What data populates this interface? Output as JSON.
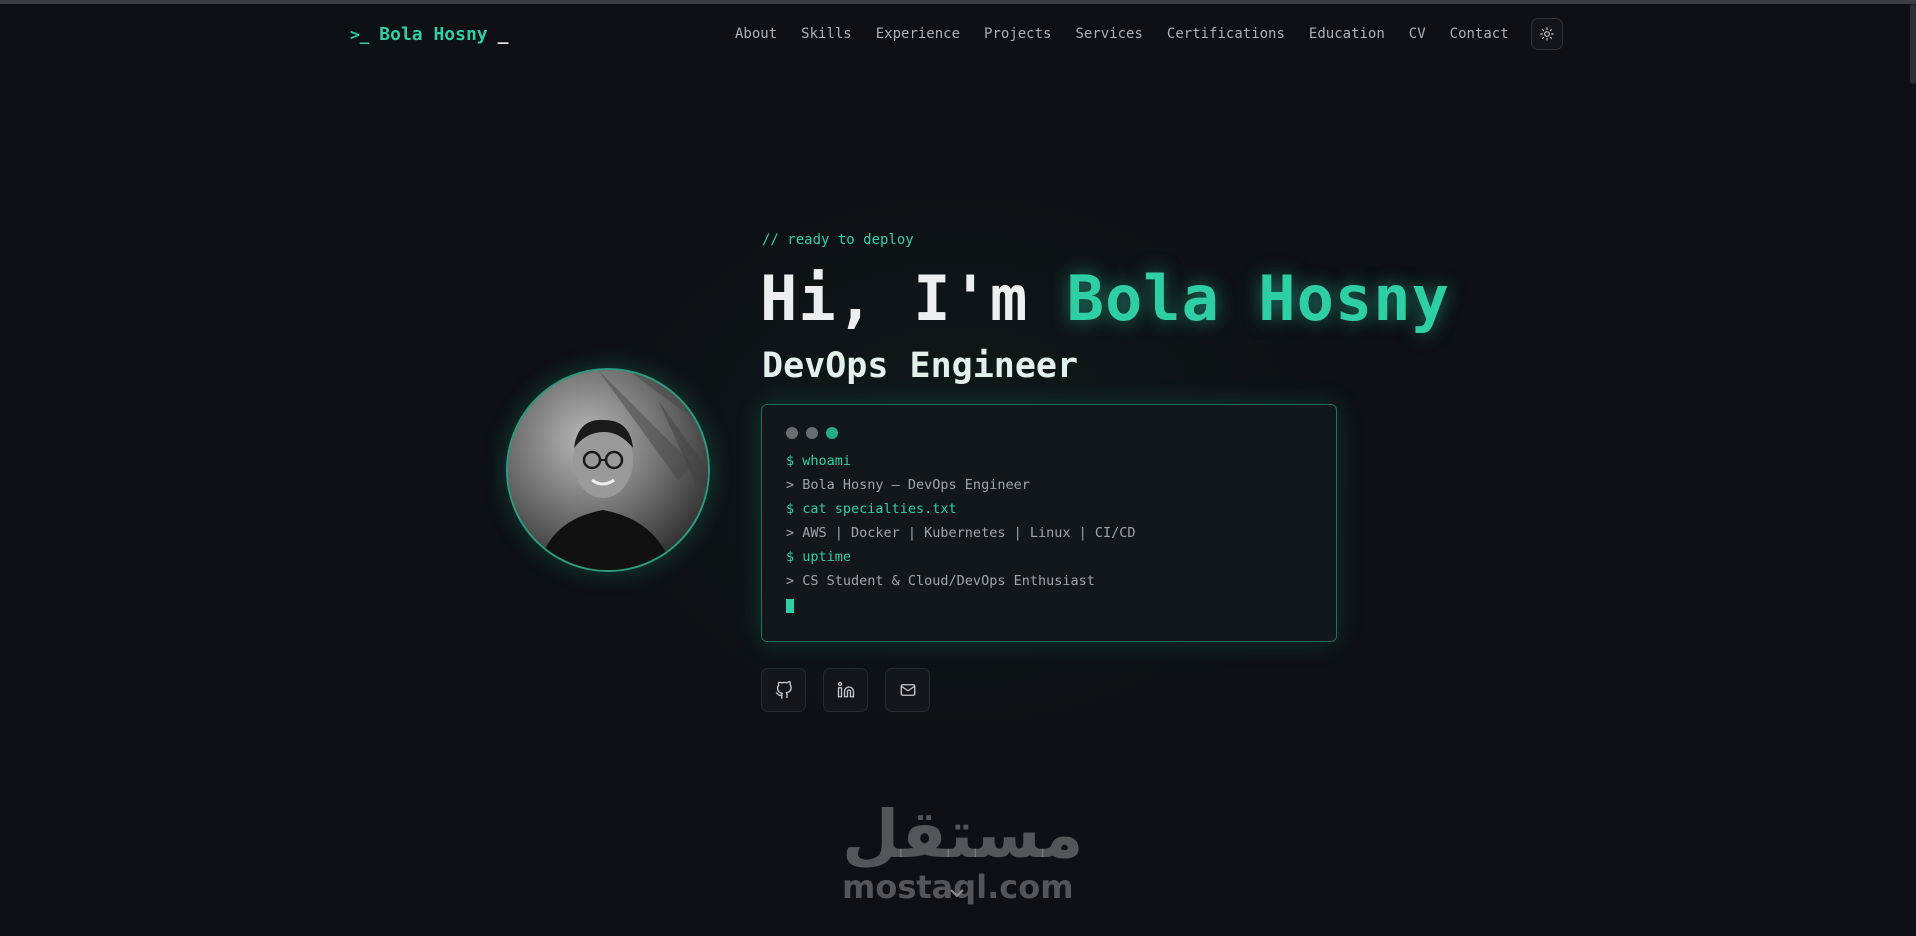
{
  "colors": {
    "accent": "#2ecfa4",
    "background": "#0d1014",
    "dot_gray": "#6b6f73",
    "dot_green": "#1fae88"
  },
  "nav": {
    "logo": {
      "icon": "terminal-prompt-icon",
      "text": "Bola Hosny",
      "cursor": "_"
    },
    "links": [
      "About",
      "Skills",
      "Experience",
      "Projects",
      "Services",
      "Certifications",
      "Education",
      "CV",
      "Contact"
    ],
    "theme_toggle_icon": "sun-icon"
  },
  "hero": {
    "tagline": "// ready to deploy",
    "greeting": "Hi, I'm ",
    "name": "Bola Hosny",
    "role": "DevOps Engineer",
    "avatar_icon": "profile-photo",
    "terminal": {
      "lines": [
        {
          "type": "cmd",
          "text": "$ whoami"
        },
        {
          "type": "out",
          "text": "> Bola Hosny — DevOps Engineer"
        },
        {
          "type": "cmd",
          "text": "$ cat specialties.txt"
        },
        {
          "type": "out",
          "text": "> AWS | Docker | Kubernetes | Linux | CI/CD"
        },
        {
          "type": "cmd",
          "text": "$ uptime"
        },
        {
          "type": "out",
          "text": "> CS Student & Cloud/DevOps Enthusiast"
        }
      ]
    },
    "socials": [
      "github-icon",
      "linkedin-icon",
      "mail-icon"
    ]
  },
  "watermark": {
    "arabic": "مستقل",
    "url": "mostaql.com"
  }
}
